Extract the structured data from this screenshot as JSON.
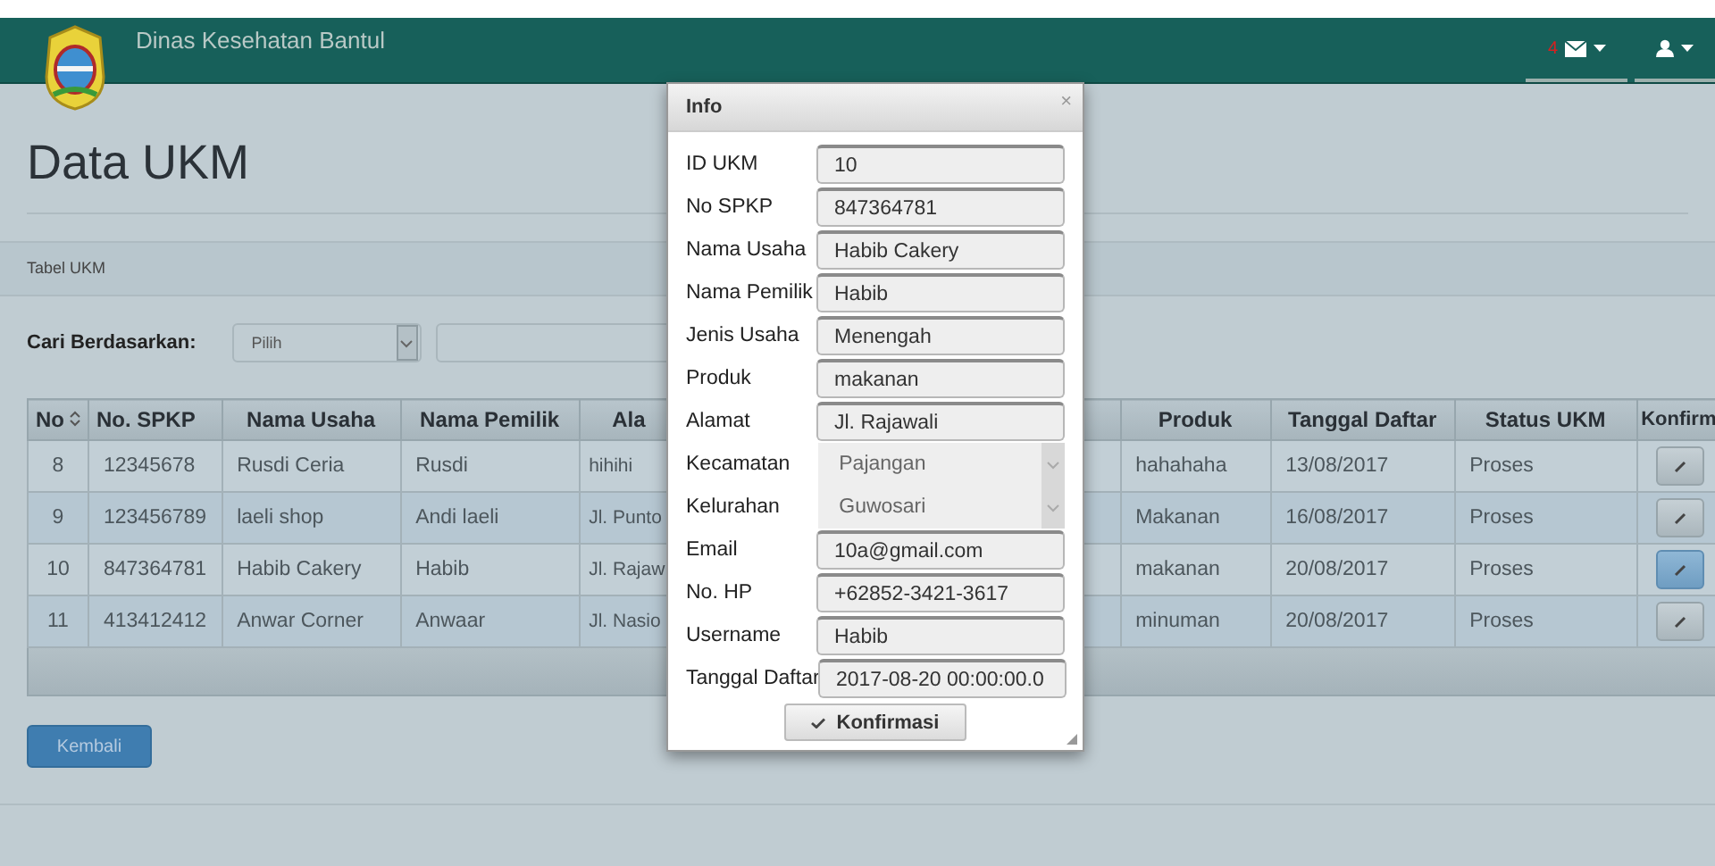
{
  "navbar": {
    "title": "Dinas Kesehatan Bantul",
    "mail_count": "4"
  },
  "page_title": "Data UKM",
  "panel_title": "Tabel UKM",
  "search": {
    "label": "Cari Berdasarkan:",
    "select_value": "Pilih"
  },
  "table": {
    "columns": [
      "No",
      "No. SPKP",
      "Nama Usaha",
      "Nama Pemilik",
      "Ala",
      "Produk",
      "Tanggal Daftar",
      "Status UKM",
      "Konfirm"
    ],
    "rows": [
      {
        "cells": [
          "8",
          "12345678",
          "Rusdi Ceria",
          "Rusdi",
          "hihihi",
          "hahahaha",
          "13/08/2017",
          "Proses"
        ],
        "highlighted": false
      },
      {
        "cells": [
          "9",
          "123456789",
          "laeli shop",
          "Andi laeli",
          "Jl. Punto",
          "Makanan",
          "16/08/2017",
          "Proses"
        ],
        "highlighted": false
      },
      {
        "cells": [
          "10",
          "847364781",
          "Habib Cakery",
          "Habib",
          "Jl. Rajaw",
          "makanan",
          "20/08/2017",
          "Proses"
        ],
        "highlighted": true
      },
      {
        "cells": [
          "11",
          "413412412",
          "Anwar Corner",
          "Anwaar",
          "Jl. Nasio",
          "minuman",
          "20/08/2017",
          "Proses"
        ],
        "highlighted": false
      }
    ]
  },
  "back_button": "Kembali",
  "dialog": {
    "title": "Info",
    "close": "×",
    "fields": [
      {
        "label": "ID UKM",
        "value": "10",
        "kind": "input"
      },
      {
        "label": "No SPKP",
        "value": "847364781",
        "kind": "input"
      },
      {
        "label": "Nama Usaha",
        "value": "Habib Cakery",
        "kind": "input"
      },
      {
        "label": "Nama Pemilik",
        "value": "Habib",
        "kind": "input"
      },
      {
        "label": "Jenis Usaha",
        "value": "Menengah",
        "kind": "input"
      },
      {
        "label": "Produk",
        "value": "makanan",
        "kind": "input"
      },
      {
        "label": "Alamat",
        "value": "Jl. Rajawali",
        "kind": "input"
      },
      {
        "label": "Kecamatan",
        "value": "Pajangan",
        "kind": "select"
      },
      {
        "label": "Kelurahan",
        "value": "Guwosari",
        "kind": "select"
      },
      {
        "label": "Email",
        "value": "10a@gmail.com",
        "kind": "input"
      },
      {
        "label": "No. HP",
        "value": "+62852-3421-3617",
        "kind": "input"
      },
      {
        "label": "Username",
        "value": "Habib",
        "kind": "input"
      },
      {
        "label": "Tanggal Daftar",
        "value": "2017-08-20 00:00:00.0",
        "kind": "input"
      }
    ],
    "confirm_button": "Konfirmasi"
  }
}
